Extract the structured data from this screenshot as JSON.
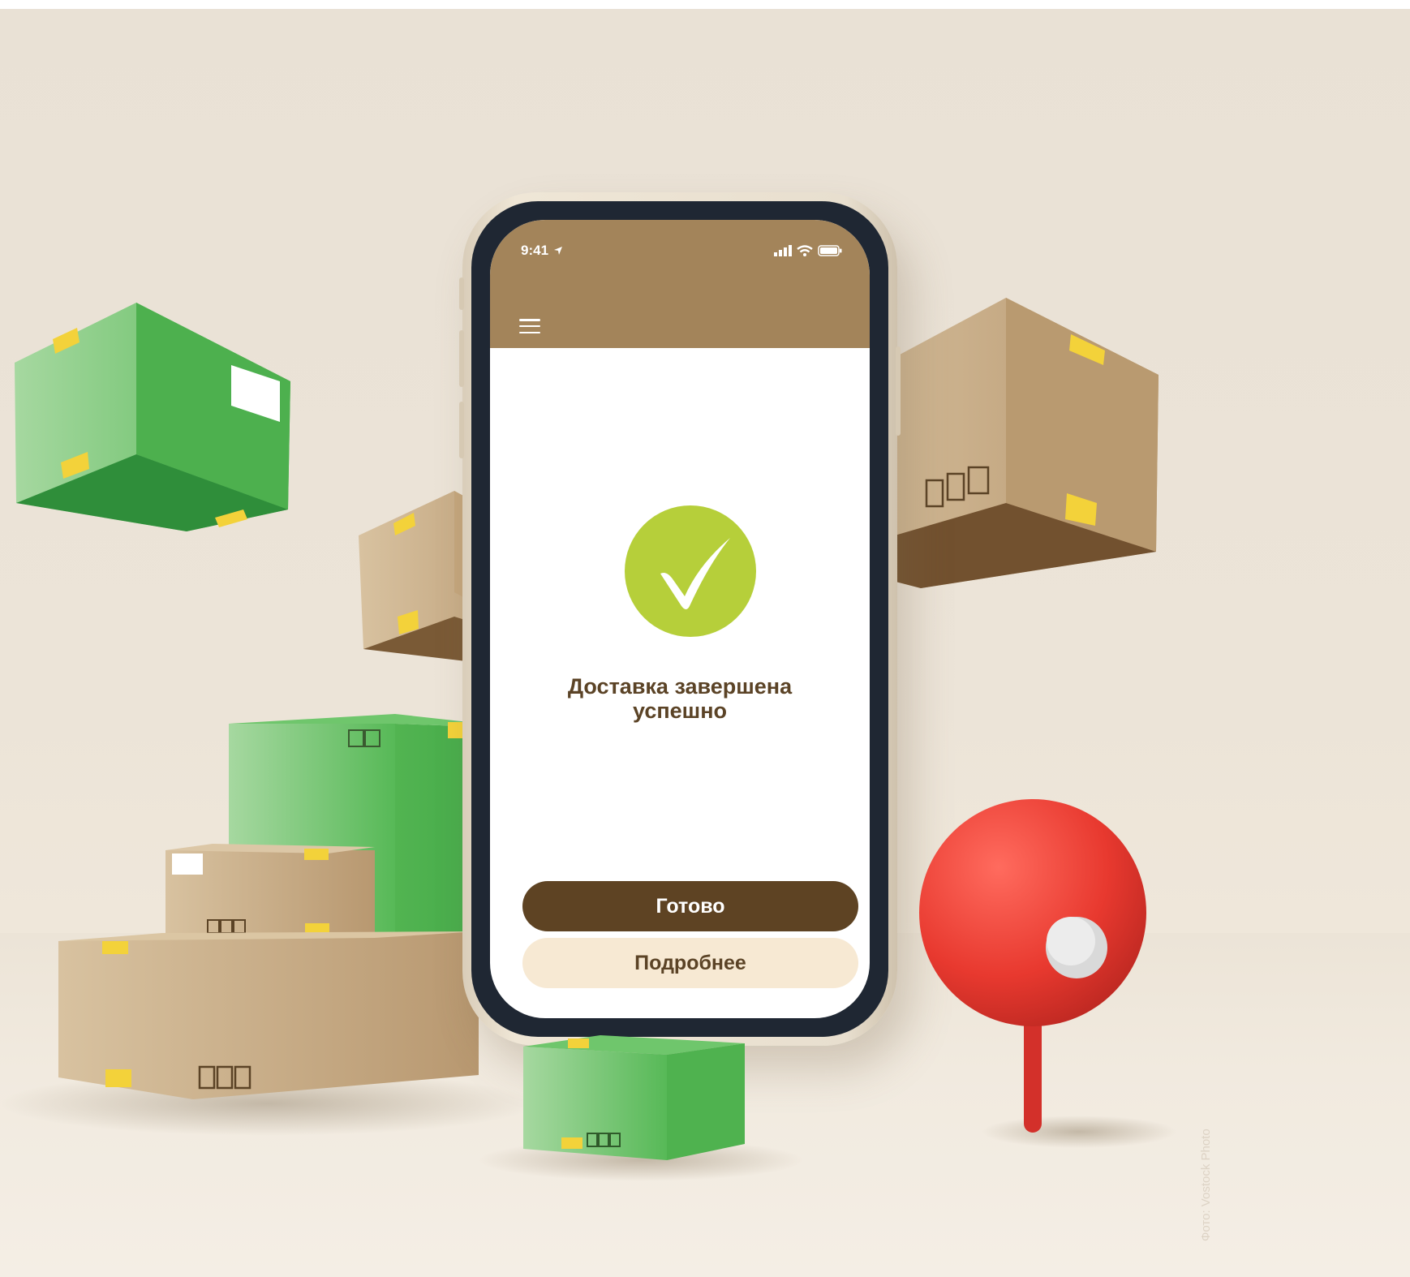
{
  "phone": {
    "status_bar": {
      "time": "9:41",
      "location_icon": "location-arrow-icon",
      "signal_icon": "signal-bars-icon",
      "wifi_icon": "wifi-icon",
      "battery_icon": "battery-icon"
    },
    "header": {
      "menu_icon": "hamburger-menu-icon",
      "color": "#a3845a"
    },
    "success": {
      "icon": "checkmark-icon",
      "icon_color": "#b6cf3a",
      "line1": "Доставка завершена",
      "line2": "успешно"
    },
    "buttons": {
      "primary_label": "Готово",
      "primary_color": "#5e4323",
      "secondary_label": "Подробнее",
      "secondary_color": "#f7e9d3"
    }
  },
  "scene": {
    "objects": [
      "cardboard-box-icon",
      "green-box-icon",
      "map-pin-icon"
    ],
    "pin_color": "#e53935"
  },
  "credit": "Фото: Vostock Photo"
}
